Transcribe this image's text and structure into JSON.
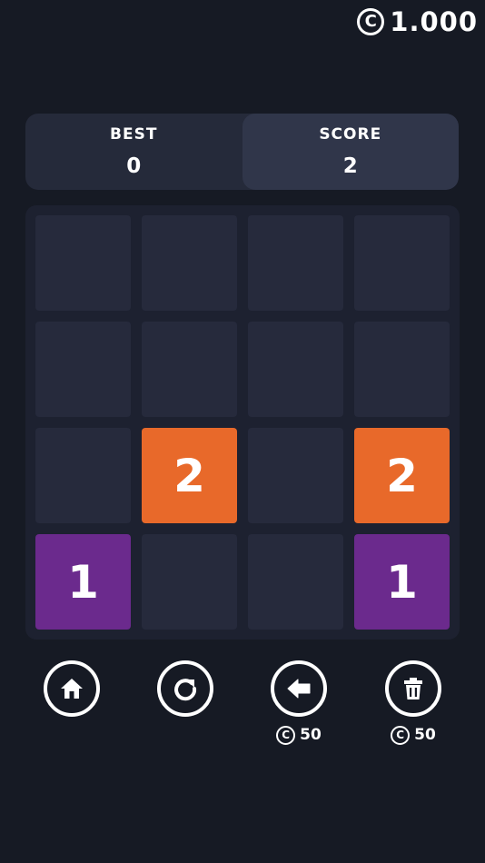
{
  "coins": {
    "symbol": "C",
    "value": "1.000"
  },
  "scoreboard": {
    "best": {
      "label": "BEST",
      "value": "0"
    },
    "score": {
      "label": "SCORE",
      "value": "2"
    }
  },
  "board": {
    "size": 4,
    "tiles": [
      [
        "",
        "",
        "",
        ""
      ],
      [
        "",
        "",
        "",
        ""
      ],
      [
        "",
        "2",
        "",
        "2"
      ],
      [
        "1",
        "",
        "",
        "1"
      ]
    ],
    "tile_colors": {
      "1": "#6b2a8d",
      "2": "#e8692a",
      "empty": "#262a3c"
    }
  },
  "actions": {
    "home": {
      "icon": "home-icon"
    },
    "restart": {
      "icon": "restart-icon"
    },
    "undo": {
      "icon": "undo-icon",
      "cost_symbol": "C",
      "cost": "50"
    },
    "delete": {
      "icon": "trash-icon",
      "cost_symbol": "C",
      "cost": "50"
    }
  }
}
